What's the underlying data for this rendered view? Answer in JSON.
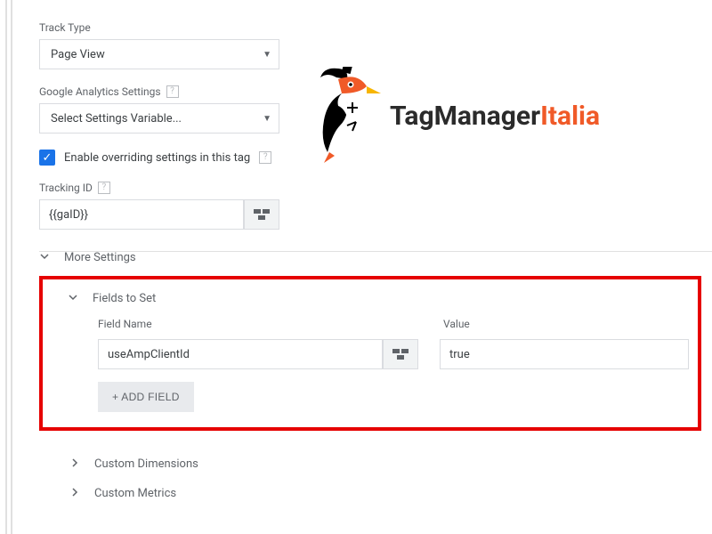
{
  "trackType": {
    "label": "Track Type",
    "value": "Page View"
  },
  "gaSettings": {
    "label": "Google Analytics Settings",
    "value": "Select Settings Variable..."
  },
  "overrideCheckbox": {
    "label": "Enable overriding settings in this tag",
    "checked": true
  },
  "trackingID": {
    "label": "Tracking ID",
    "value": "{{gaID}}"
  },
  "moreSettings": {
    "label": "More Settings"
  },
  "fieldsToSet": {
    "label": "Fields to Set",
    "columns": {
      "name": "Field Name",
      "value": "Value"
    },
    "rows": [
      {
        "name": "useAmpClientId",
        "value": "true"
      }
    ],
    "addButton": "+ ADD FIELD"
  },
  "customDimensions": {
    "label": "Custom Dimensions"
  },
  "customMetrics": {
    "label": "Custom Metrics"
  },
  "brand": {
    "part1": "TagManager",
    "part2": "Italia"
  }
}
